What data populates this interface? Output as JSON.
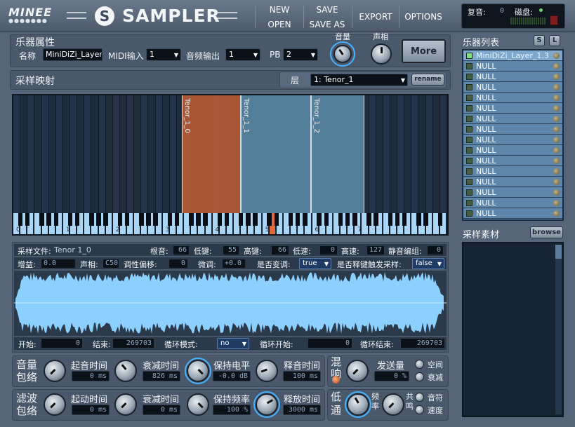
{
  "app": {
    "logo": "MINEE",
    "title": "SAMPLER"
  },
  "menu": {
    "new": "NEW",
    "open": "OPEN",
    "save": "SAVE",
    "save_as": "SAVE AS",
    "export": "EXPORT",
    "options": "OPTIONS"
  },
  "status": {
    "poly_label": "复音:",
    "poly_value": "0",
    "disk_label": "磁盘:"
  },
  "instrument": {
    "section": "乐器属性",
    "name_label": "名称",
    "name_value": "MiniDiZi_Layer",
    "midi_label": "MIDI输入",
    "midi_value": "1",
    "audio_label": "音频输出",
    "audio_value": "1",
    "pb_label": "PB",
    "pb_value": "2",
    "volume_label": "音量",
    "pan_label": "声相",
    "more": "More"
  },
  "instrument_list": {
    "title": "乐器列表",
    "s_btn": "S",
    "l_btn": "L",
    "items": [
      "MiniDiZi_Layer_1.3",
      "NULL",
      "NULL",
      "NULL",
      "NULL",
      "NULL",
      "NULL",
      "NULL",
      "NULL",
      "NULL",
      "NULL",
      "NULL",
      "NULL",
      "NULL",
      "NULL",
      "NULL"
    ]
  },
  "sample_material": {
    "title": "采样素材",
    "browse": "browse"
  },
  "mapping": {
    "title": "采样映射",
    "layer_label": "层",
    "layer_value": "1: Tenor_1",
    "rename": "rename",
    "zones": [
      "Tenor_1_0",
      "Tenor_1_1",
      "Tenor_1_2"
    ],
    "octaves": [
      "0",
      "1",
      "2",
      "3",
      "4",
      "5",
      "6",
      "7"
    ]
  },
  "sample": {
    "file_label": "采样文件:",
    "file_value": "Tenor 1_0",
    "root_label": "根音:",
    "root_value": "66",
    "low_key_label": "低键:",
    "low_key_value": "55",
    "high_key_label": "高键:",
    "high_key_value": "66",
    "low_vel_label": "低速:",
    "low_vel_value": "0",
    "high_vel_label": "高速:",
    "high_vel_value": "127",
    "mute_group_label": "静音编组:",
    "mute_group_value": "0",
    "gain_label": "增益:",
    "gain_value": "0.0",
    "pan_label": "声相:",
    "pan_value": "C50",
    "tune_label": "调性偏移:",
    "tune_value": "0",
    "fine_label": "微调:",
    "fine_value": "+0.0",
    "transpose_label": "是否变调:",
    "transpose_value": "true",
    "release_trig_label": "是否释键触发采样:",
    "release_trig_value": "false",
    "start_label": "开始:",
    "start_value": "0",
    "end_label": "结束:",
    "end_value": "269703",
    "loop_mode_label": "循环模式:",
    "loop_mode_value": "no",
    "loop_start_label": "循环开始:",
    "loop_start_value": "0",
    "loop_end_label": "循环结束:",
    "loop_end_value": "269703"
  },
  "amp_env": {
    "title1": "音量",
    "title2": "包络",
    "attack_label": "起音时间",
    "attack_value": "0 ms",
    "decay_label": "衰减时间",
    "decay_value": "826 ms",
    "sustain_label": "保持电平",
    "sustain_value": "-0.0 dB",
    "release_label": "释音时间",
    "release_value": "100 ms"
  },
  "filter_env": {
    "title1": "滤波",
    "title2": "包络",
    "attack_label": "起动时间",
    "attack_value": "0 ms",
    "decay_label": "衰减时间",
    "decay_value": "0 ms",
    "sustain_label": "保持频率",
    "sustain_value": "100 %",
    "release_label": "释放时间",
    "release_value": "3000 ms"
  },
  "reverb": {
    "title1": "混",
    "title2": "响",
    "send_label": "发送量",
    "send_value": "0 %",
    "space_label": "空间",
    "decay_label": "衰减"
  },
  "lowpass": {
    "title1": "低",
    "title2": "通",
    "freq_label1": "频",
    "freq_label2": "率",
    "res_label1": "共",
    "res_label2": "鸣",
    "note_label": "音符",
    "vel_label": "速度"
  },
  "colors": {
    "zone_active": "#b05a35",
    "zone": "#56839f",
    "accent": "#45b3ff",
    "wave": "#8cd0ff"
  }
}
